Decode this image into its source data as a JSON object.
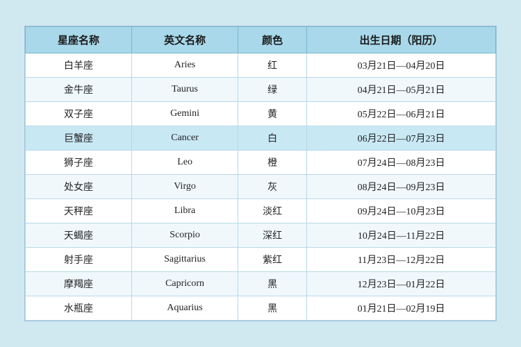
{
  "table": {
    "headers": [
      "星座名称",
      "英文名称",
      "颜色",
      "出生日期（阳历）"
    ],
    "rows": [
      {
        "chinese": "白羊座",
        "english": "Aries",
        "color": "红",
        "dates": "03月21日—04月20日",
        "highlight": false
      },
      {
        "chinese": "金牛座",
        "english": "Taurus",
        "color": "绿",
        "dates": "04月21日—05月21日",
        "highlight": false
      },
      {
        "chinese": "双子座",
        "english": "Gemini",
        "color": "黄",
        "dates": "05月22日—06月21日",
        "highlight": false
      },
      {
        "chinese": "巨蟹座",
        "english": "Cancer",
        "color": "白",
        "dates": "06月22日—07月23日",
        "highlight": true
      },
      {
        "chinese": "狮子座",
        "english": "Leo",
        "color": "橙",
        "dates": "07月24日—08月23日",
        "highlight": false
      },
      {
        "chinese": "处女座",
        "english": "Virgo",
        "color": "灰",
        "dates": "08月24日—09月23日",
        "highlight": false
      },
      {
        "chinese": "天秤座",
        "english": "Libra",
        "color": "淡红",
        "dates": "09月24日—10月23日",
        "highlight": false
      },
      {
        "chinese": "天蝎座",
        "english": "Scorpio",
        "color": "深红",
        "dates": "10月24日—11月22日",
        "highlight": false
      },
      {
        "chinese": "射手座",
        "english": "Sagittarius",
        "color": "紫红",
        "dates": "11月23日—12月22日",
        "highlight": false
      },
      {
        "chinese": "摩羯座",
        "english": "Capricorn",
        "color": "黑",
        "dates": "12月23日—01月22日",
        "highlight": false
      },
      {
        "chinese": "水瓶座",
        "english": "Aquarius",
        "color": "黑",
        "dates": "01月21日—02月19日",
        "highlight": false
      }
    ]
  }
}
